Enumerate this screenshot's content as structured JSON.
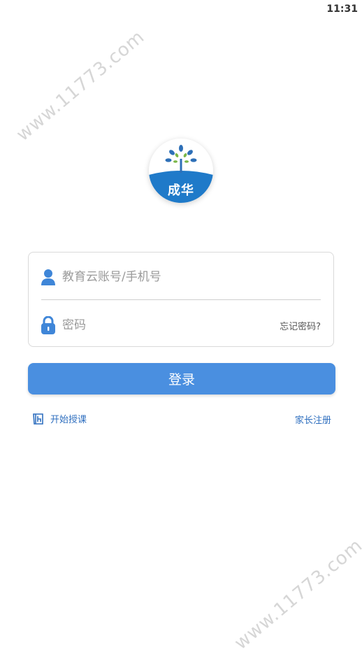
{
  "status_bar": {
    "time": "11:31"
  },
  "watermarks": [
    "www.11773.com",
    "www.11773.com"
  ],
  "logo": {
    "text": "成华",
    "icon": "tree-logo-icon"
  },
  "login_form": {
    "account": {
      "placeholder": "教育云账号/手机号",
      "icon": "user-icon"
    },
    "password": {
      "placeholder": "密码",
      "icon": "lock-icon"
    },
    "forgot_label": "忘记密码?"
  },
  "login_button": {
    "label": "登录"
  },
  "footer_links": {
    "start_teaching": {
      "label": "开始授课",
      "icon": "book-icon"
    },
    "parent_register": {
      "label": "家长注册"
    }
  },
  "colors": {
    "accent": "#4a8fe0",
    "link": "#2f6fbf",
    "logo_blue": "#1f7ac9"
  }
}
